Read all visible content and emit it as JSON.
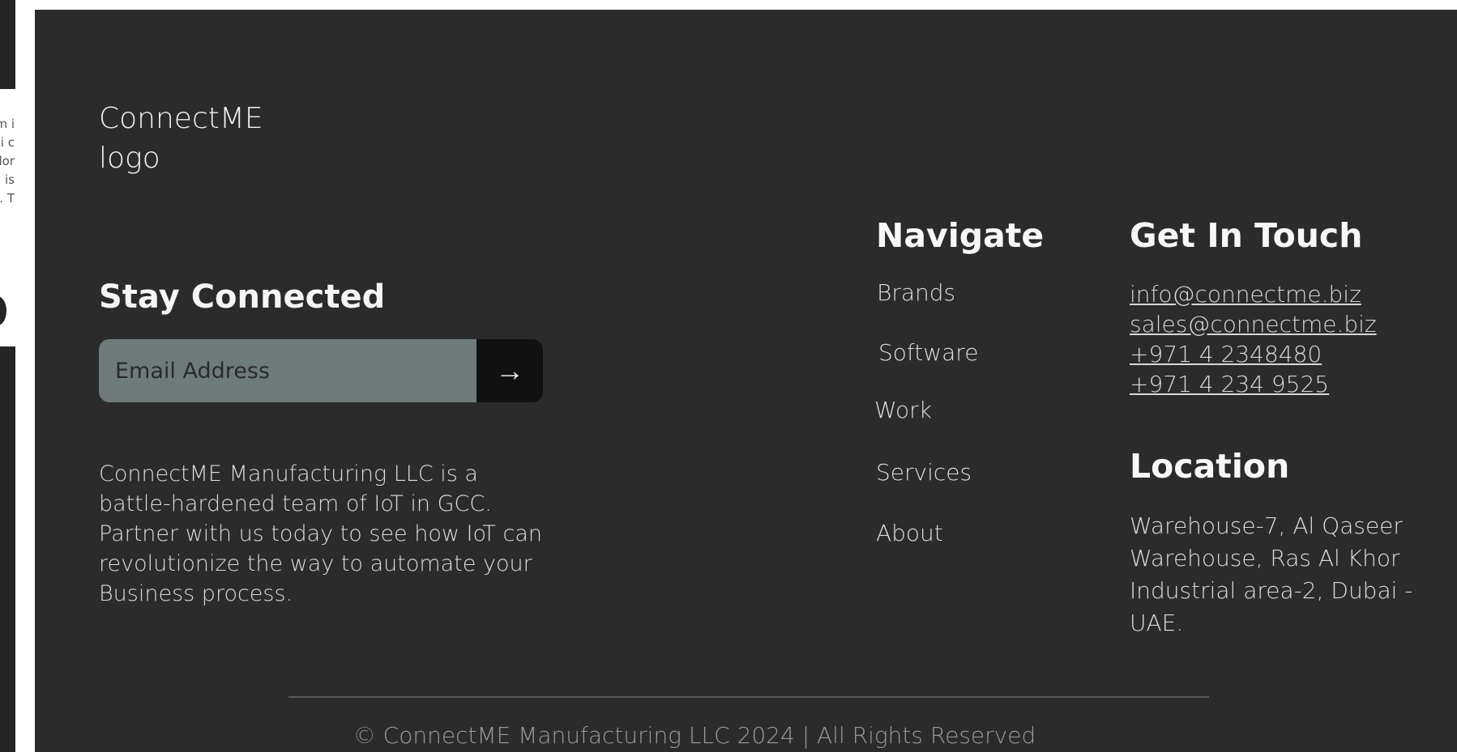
{
  "remnant": {
    "fragments": [
      "m i",
      "oi c",
      "lor",
      "is",
      ". T"
    ]
  },
  "footer": {
    "logo_text": "ConnectME logo",
    "newsletter": {
      "heading": "Stay Connected",
      "email_placeholder": "Email Address",
      "submit_glyph": "→"
    },
    "about_text": "ConnectME Manufacturing LLC is a battle-hardened team of IoT in GCC. Partner with us today to see how IoT can revolutionize the way to automate your Business process.",
    "navigate": {
      "heading": "Navigate",
      "items": [
        "Brands",
        "Software",
        "Work",
        "Services",
        "About"
      ]
    },
    "contact": {
      "heading": "Get In Touch",
      "emails": [
        "info@connectme.biz",
        "sales@connectme.biz"
      ],
      "phones": [
        "+971 4 2348480",
        "+971 4 234 9525"
      ]
    },
    "location": {
      "heading": "Location",
      "address": "Warehouse-7, Al Qaseer Warehouse, Ras Al Khor Industrial area-2, Dubai - UAE."
    },
    "copyright": "© ConnectME Manufacturing LLC 2024 | All Rights Reserved"
  }
}
